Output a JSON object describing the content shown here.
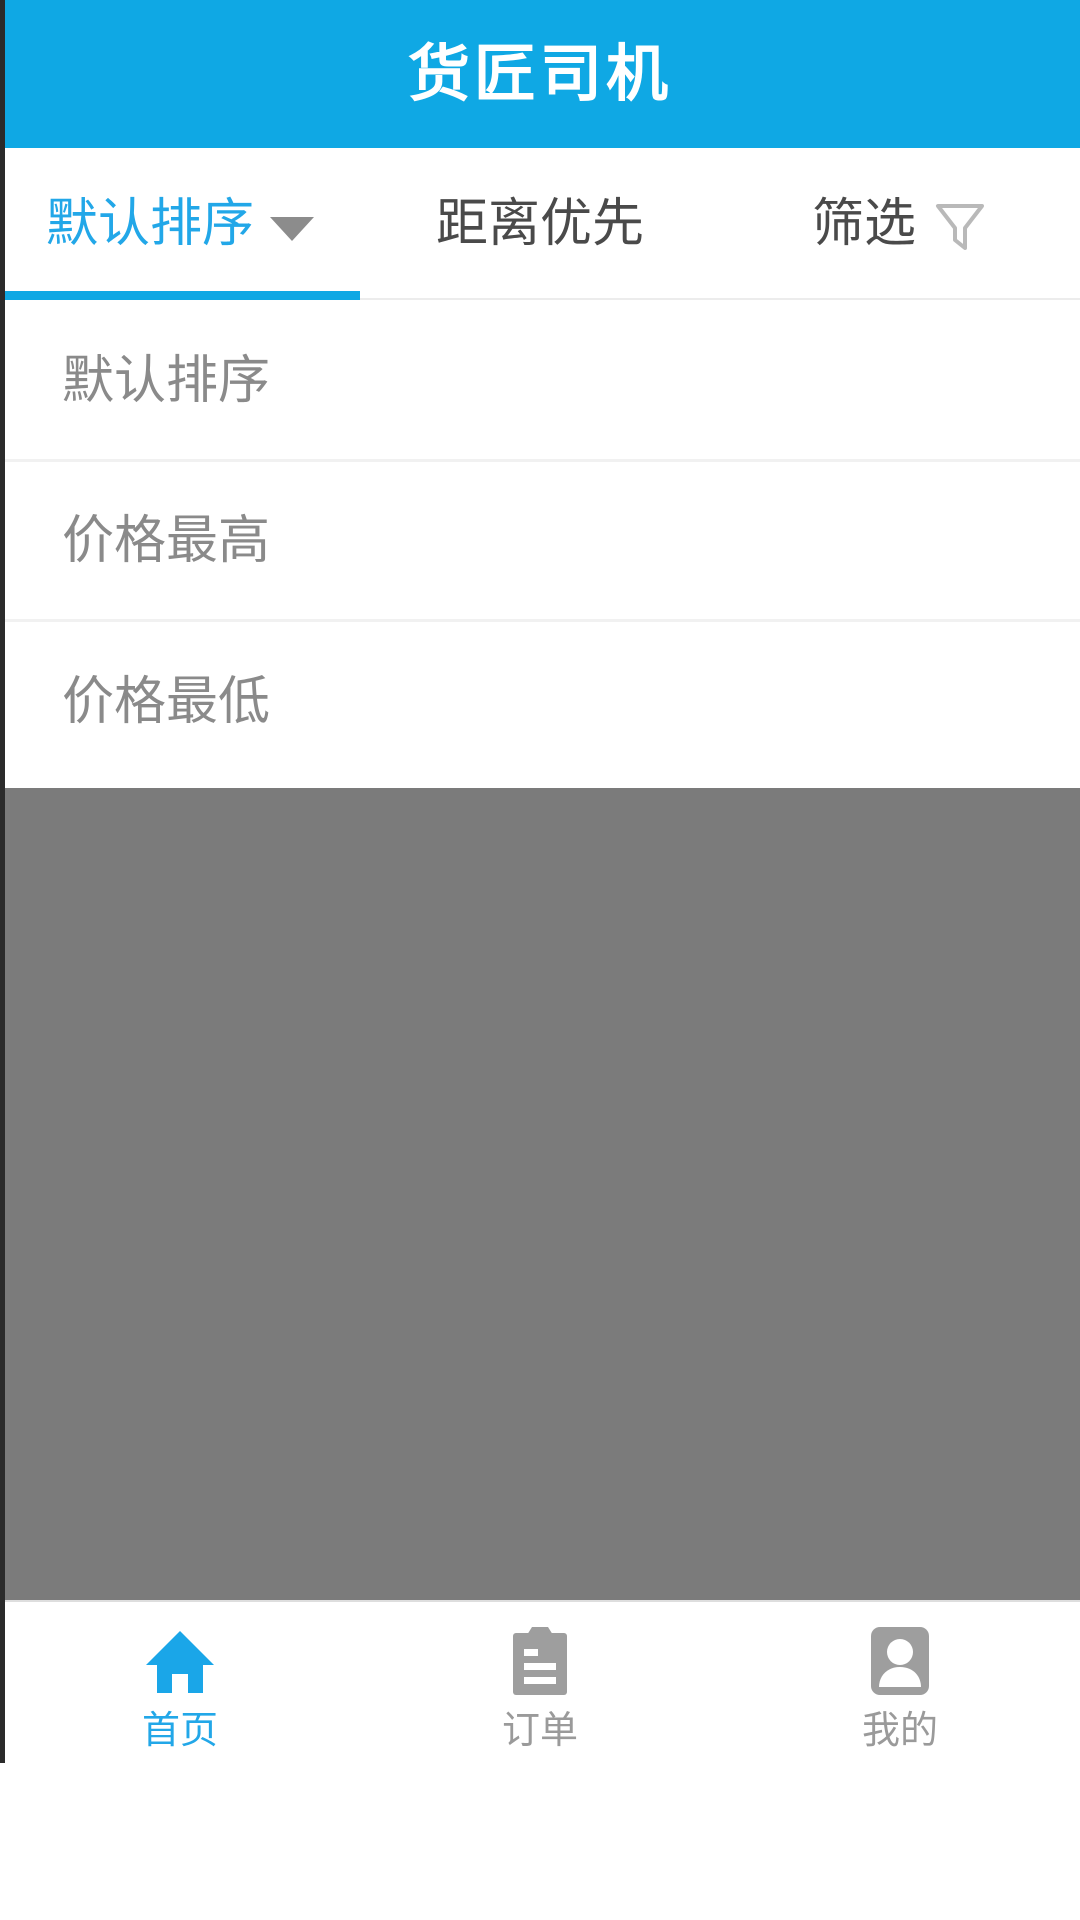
{
  "header": {
    "title": "货匠司机",
    "background_color": "#0fa8e4",
    "text_color": "#ffffff"
  },
  "tabbar": {
    "active_color": "#22a7e8",
    "inactive_color": "#4a4a4a",
    "underline_color": "#0fa8e4",
    "tabs": [
      {
        "label": "默认排序",
        "icon": "chevron-down-icon",
        "active": true
      },
      {
        "label": "距离优先",
        "icon": "",
        "active": false
      },
      {
        "label": "筛选",
        "icon": "funnel-icon",
        "active": false
      }
    ]
  },
  "dropdown": {
    "open": true,
    "items": [
      {
        "label": "默认排序"
      },
      {
        "label": "价格最高"
      },
      {
        "label": "价格最低"
      }
    ]
  },
  "scrim": {
    "color": "#7b7b7b"
  },
  "bottom_nav": {
    "active_color": "#22a7e8",
    "inactive_color": "#9a9a9a",
    "items": [
      {
        "label": "首页",
        "icon": "home-icon",
        "active": true
      },
      {
        "label": "订单",
        "icon": "clipboard-icon",
        "active": false
      },
      {
        "label": "我的",
        "icon": "user-icon",
        "active": false
      }
    ]
  }
}
